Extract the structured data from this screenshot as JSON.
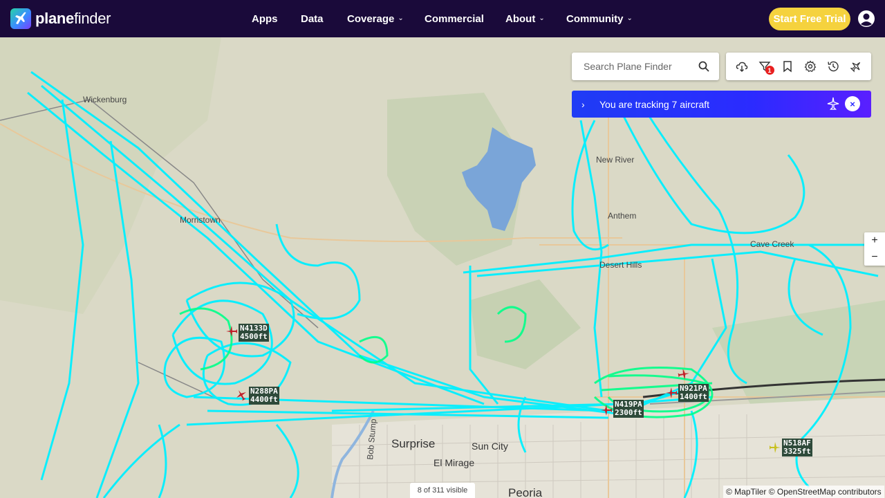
{
  "brand": {
    "name_bold": "plane",
    "name_rest": "finder"
  },
  "nav": {
    "items": [
      {
        "label": "Apps",
        "dropdown": false
      },
      {
        "label": "Data",
        "dropdown": false
      },
      {
        "label": "Coverage",
        "dropdown": true
      },
      {
        "label": "Commercial",
        "dropdown": false
      },
      {
        "label": "About",
        "dropdown": true
      },
      {
        "label": "Community",
        "dropdown": true
      }
    ],
    "trial_button": "Start Free Trial"
  },
  "search": {
    "placeholder": "Search Plane Finder"
  },
  "toolbar": {
    "icons": [
      "cloud-radar-icon",
      "filter-icon",
      "bookmark-icon",
      "settings-icon",
      "history-icon",
      "plane-settings-icon"
    ],
    "filter_badge": "1"
  },
  "tracking": {
    "text": "You are tracking 7 aircraft",
    "close": "×"
  },
  "zoom": {
    "in": "+",
    "out": "−"
  },
  "places": [
    {
      "name": "Wickenburg",
      "size": "small"
    },
    {
      "name": "New River",
      "size": "small"
    },
    {
      "name": "Anthem",
      "size": "small"
    },
    {
      "name": "Cave Creek",
      "size": "small"
    },
    {
      "name": "Desert Hills",
      "size": "small"
    },
    {
      "name": "Morristown",
      "size": "small"
    },
    {
      "name": "Surprise",
      "size": "big"
    },
    {
      "name": "Sun City",
      "size": "small"
    },
    {
      "name": "El Mirage",
      "size": "small"
    },
    {
      "name": "Peoria",
      "size": "big"
    },
    {
      "name": "Bob Stump",
      "size": "small"
    }
  ],
  "aircraft": [
    {
      "callsign": "N4133D",
      "altitude": "4500ft",
      "color": "#c0202a"
    },
    {
      "callsign": "N288PA",
      "altitude": "4400ft",
      "color": "#c0202a"
    },
    {
      "callsign": "N419PA",
      "altitude": "2300ft",
      "color": "#c0202a"
    },
    {
      "callsign": "N921PA",
      "altitude": "1400ft",
      "color": "#c0202a"
    },
    {
      "callsign": "N518AF",
      "altitude": "3325ft",
      "color": "#c8c020"
    }
  ],
  "status": {
    "visible": "8 of 311 visible"
  },
  "attribution": "© MapTiler © OpenStreetMap contributors",
  "colors": {
    "topbar": "#1a0a3a",
    "trial": "#f5d23e",
    "track_primary": "#00f0ff",
    "track_secondary": "#00ff88",
    "tracking_banner": "#2b2bff"
  }
}
